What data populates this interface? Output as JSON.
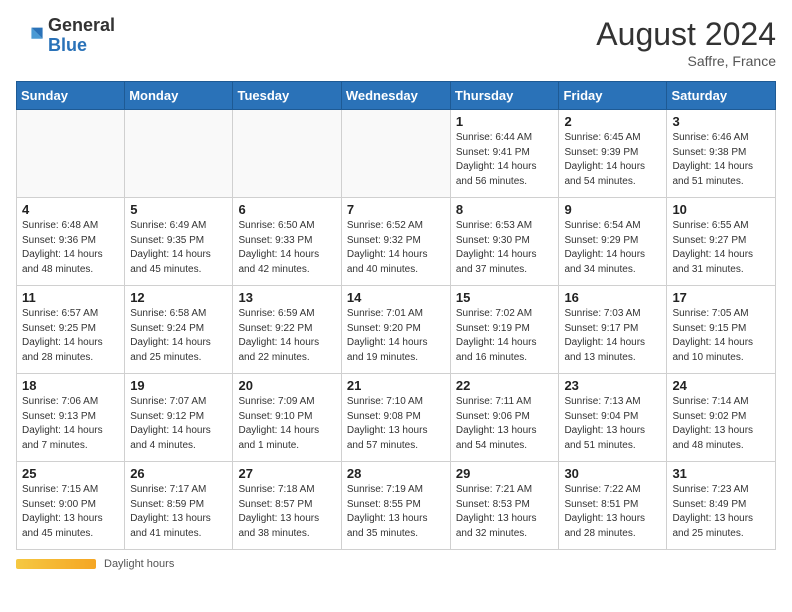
{
  "header": {
    "logo_general": "General",
    "logo_blue": "Blue",
    "month_year": "August 2024",
    "location": "Saffre, France"
  },
  "weekdays": [
    "Sunday",
    "Monday",
    "Tuesday",
    "Wednesday",
    "Thursday",
    "Friday",
    "Saturday"
  ],
  "weeks": [
    [
      {
        "day": "",
        "info": ""
      },
      {
        "day": "",
        "info": ""
      },
      {
        "day": "",
        "info": ""
      },
      {
        "day": "",
        "info": ""
      },
      {
        "day": "1",
        "info": "Sunrise: 6:44 AM\nSunset: 9:41 PM\nDaylight: 14 hours\nand 56 minutes."
      },
      {
        "day": "2",
        "info": "Sunrise: 6:45 AM\nSunset: 9:39 PM\nDaylight: 14 hours\nand 54 minutes."
      },
      {
        "day": "3",
        "info": "Sunrise: 6:46 AM\nSunset: 9:38 PM\nDaylight: 14 hours\nand 51 minutes."
      }
    ],
    [
      {
        "day": "4",
        "info": "Sunrise: 6:48 AM\nSunset: 9:36 PM\nDaylight: 14 hours\nand 48 minutes."
      },
      {
        "day": "5",
        "info": "Sunrise: 6:49 AM\nSunset: 9:35 PM\nDaylight: 14 hours\nand 45 minutes."
      },
      {
        "day": "6",
        "info": "Sunrise: 6:50 AM\nSunset: 9:33 PM\nDaylight: 14 hours\nand 42 minutes."
      },
      {
        "day": "7",
        "info": "Sunrise: 6:52 AM\nSunset: 9:32 PM\nDaylight: 14 hours\nand 40 minutes."
      },
      {
        "day": "8",
        "info": "Sunrise: 6:53 AM\nSunset: 9:30 PM\nDaylight: 14 hours\nand 37 minutes."
      },
      {
        "day": "9",
        "info": "Sunrise: 6:54 AM\nSunset: 9:29 PM\nDaylight: 14 hours\nand 34 minutes."
      },
      {
        "day": "10",
        "info": "Sunrise: 6:55 AM\nSunset: 9:27 PM\nDaylight: 14 hours\nand 31 minutes."
      }
    ],
    [
      {
        "day": "11",
        "info": "Sunrise: 6:57 AM\nSunset: 9:25 PM\nDaylight: 14 hours\nand 28 minutes."
      },
      {
        "day": "12",
        "info": "Sunrise: 6:58 AM\nSunset: 9:24 PM\nDaylight: 14 hours\nand 25 minutes."
      },
      {
        "day": "13",
        "info": "Sunrise: 6:59 AM\nSunset: 9:22 PM\nDaylight: 14 hours\nand 22 minutes."
      },
      {
        "day": "14",
        "info": "Sunrise: 7:01 AM\nSunset: 9:20 PM\nDaylight: 14 hours\nand 19 minutes."
      },
      {
        "day": "15",
        "info": "Sunrise: 7:02 AM\nSunset: 9:19 PM\nDaylight: 14 hours\nand 16 minutes."
      },
      {
        "day": "16",
        "info": "Sunrise: 7:03 AM\nSunset: 9:17 PM\nDaylight: 14 hours\nand 13 minutes."
      },
      {
        "day": "17",
        "info": "Sunrise: 7:05 AM\nSunset: 9:15 PM\nDaylight: 14 hours\nand 10 minutes."
      }
    ],
    [
      {
        "day": "18",
        "info": "Sunrise: 7:06 AM\nSunset: 9:13 PM\nDaylight: 14 hours\nand 7 minutes."
      },
      {
        "day": "19",
        "info": "Sunrise: 7:07 AM\nSunset: 9:12 PM\nDaylight: 14 hours\nand 4 minutes."
      },
      {
        "day": "20",
        "info": "Sunrise: 7:09 AM\nSunset: 9:10 PM\nDaylight: 14 hours\nand 1 minute."
      },
      {
        "day": "21",
        "info": "Sunrise: 7:10 AM\nSunset: 9:08 PM\nDaylight: 13 hours\nand 57 minutes."
      },
      {
        "day": "22",
        "info": "Sunrise: 7:11 AM\nSunset: 9:06 PM\nDaylight: 13 hours\nand 54 minutes."
      },
      {
        "day": "23",
        "info": "Sunrise: 7:13 AM\nSunset: 9:04 PM\nDaylight: 13 hours\nand 51 minutes."
      },
      {
        "day": "24",
        "info": "Sunrise: 7:14 AM\nSunset: 9:02 PM\nDaylight: 13 hours\nand 48 minutes."
      }
    ],
    [
      {
        "day": "25",
        "info": "Sunrise: 7:15 AM\nSunset: 9:00 PM\nDaylight: 13 hours\nand 45 minutes."
      },
      {
        "day": "26",
        "info": "Sunrise: 7:17 AM\nSunset: 8:59 PM\nDaylight: 13 hours\nand 41 minutes."
      },
      {
        "day": "27",
        "info": "Sunrise: 7:18 AM\nSunset: 8:57 PM\nDaylight: 13 hours\nand 38 minutes."
      },
      {
        "day": "28",
        "info": "Sunrise: 7:19 AM\nSunset: 8:55 PM\nDaylight: 13 hours\nand 35 minutes."
      },
      {
        "day": "29",
        "info": "Sunrise: 7:21 AM\nSunset: 8:53 PM\nDaylight: 13 hours\nand 32 minutes."
      },
      {
        "day": "30",
        "info": "Sunrise: 7:22 AM\nSunset: 8:51 PM\nDaylight: 13 hours\nand 28 minutes."
      },
      {
        "day": "31",
        "info": "Sunrise: 7:23 AM\nSunset: 8:49 PM\nDaylight: 13 hours\nand 25 minutes."
      }
    ]
  ],
  "footer": {
    "daylight_label": "Daylight hours"
  }
}
